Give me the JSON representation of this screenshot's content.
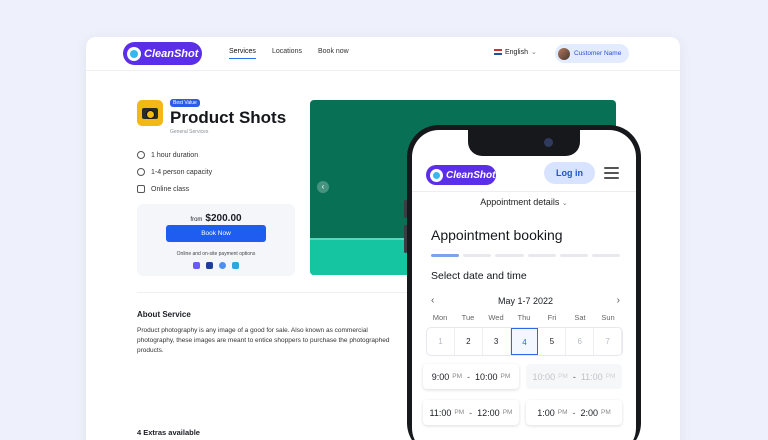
{
  "brand": {
    "name": "CleanShot",
    "color": "#5b2ee8"
  },
  "nav": {
    "links": [
      {
        "label": "Services",
        "active": true
      },
      {
        "label": "Locations",
        "active": false
      },
      {
        "label": "Book now",
        "active": false
      }
    ],
    "language": "English",
    "customer": "Customer Name"
  },
  "product": {
    "badge": "Best Value",
    "title": "Product Shots",
    "subtitle": "General Services",
    "features": [
      "1 hour duration",
      "1-4 person capacity",
      "Online class"
    ],
    "price_from": "from",
    "price": "$200.00",
    "book_label": "Book Now",
    "payment_note": "Online and on-site payment options",
    "payment_icons": [
      "stripe-icon",
      "paypal-icon",
      "search-pay-icon",
      "card-icon"
    ]
  },
  "about": {
    "heading": "About Service",
    "text": "Product photography is any image of a good for sale. Also known as commercial photography, these images are meant to entice shoppers to purchase the photographed products."
  },
  "extras": "4 Extras available",
  "phone": {
    "login_label": "Log in",
    "details_label": "Appointment details",
    "booking_heading": "Appointment booking",
    "select_label": "Select date  and time",
    "month_label": "May 1-7 2022",
    "progress_steps": 6,
    "progress_done": 1,
    "weekdays": [
      "Mon",
      "Tue",
      "Wed",
      "Thu",
      "Fri",
      "Sat",
      "Sun"
    ],
    "dates": [
      {
        "day": "1",
        "state": "muted"
      },
      {
        "day": "2",
        "state": "normal"
      },
      {
        "day": "3",
        "state": "normal"
      },
      {
        "day": "4",
        "state": "selected"
      },
      {
        "day": "5",
        "state": "normal"
      },
      {
        "day": "6",
        "state": "muted"
      },
      {
        "day": "7",
        "state": "muted"
      }
    ],
    "slots": [
      {
        "start": "9:00",
        "start_ap": "PM",
        "end": "10:00",
        "end_ap": "PM",
        "disabled": false
      },
      {
        "start": "10:00",
        "start_ap": "PM",
        "end": "11:00",
        "end_ap": "PM",
        "disabled": true
      },
      {
        "start": "11:00",
        "start_ap": "PM",
        "end": "12:00",
        "end_ap": "PM",
        "disabled": false
      },
      {
        "start": "1:00",
        "start_ap": "PM",
        "end": "2:00",
        "end_ap": "PM",
        "disabled": false
      }
    ],
    "separator": "-"
  }
}
